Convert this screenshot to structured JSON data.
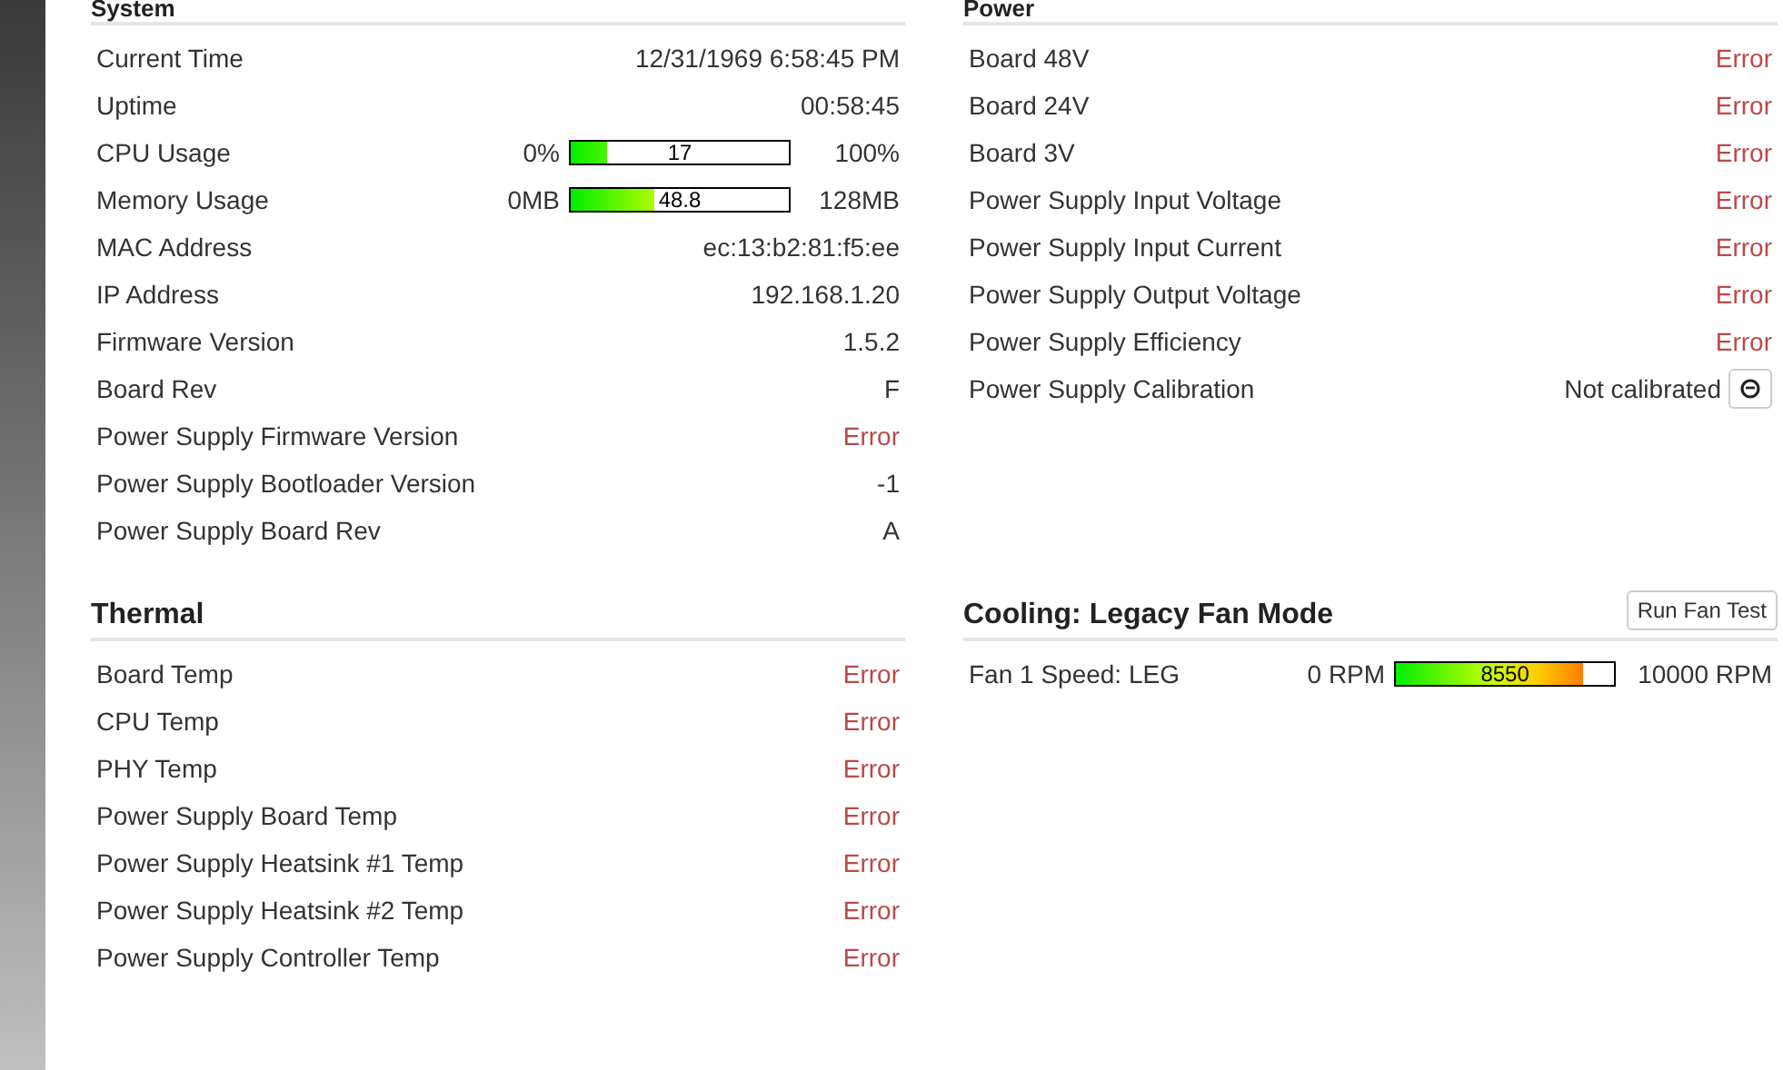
{
  "sections": [
    {
      "title": "System",
      "rows": [
        {
          "kind": "text",
          "label": "Current Time",
          "value": "12/31/1969 6:58:45 PM"
        },
        {
          "kind": "text",
          "label": "Uptime",
          "value": "00:58:45"
        },
        {
          "kind": "bar",
          "label": "CPU Usage",
          "min": "0%",
          "max": "100%",
          "reading": "17",
          "level": 0.17
        },
        {
          "kind": "bar",
          "label": "Memory Usage",
          "min": "0MB",
          "max": "128MB",
          "reading": "48.8",
          "level": 0.38
        },
        {
          "kind": "text",
          "label": "MAC Address",
          "value": "ec:13:b2:81:f5:ee"
        },
        {
          "kind": "text",
          "label": "IP Address",
          "value": "192.168.1.20"
        },
        {
          "kind": "text",
          "label": "Firmware Version",
          "value": "1.5.2"
        },
        {
          "kind": "text",
          "label": "Board Rev",
          "value": "F"
        },
        {
          "kind": "error",
          "label": "Power Supply Firmware Version",
          "value": "Error"
        },
        {
          "kind": "text",
          "label": "Power Supply Bootloader Version",
          "value": "-1"
        },
        {
          "kind": "text",
          "label": "Power Supply Board Rev",
          "value": "A"
        }
      ]
    },
    {
      "title": "Power",
      "rows": [
        {
          "kind": "error",
          "label": "Board 48V",
          "value": "Error"
        },
        {
          "kind": "error",
          "label": "Board 24V",
          "value": "Error"
        },
        {
          "kind": "error",
          "label": "Board 3V",
          "value": "Error"
        },
        {
          "kind": "error",
          "label": "Power Supply Input Voltage",
          "value": "Error"
        },
        {
          "kind": "error",
          "label": "Power Supply Input Current",
          "value": "Error"
        },
        {
          "kind": "error",
          "label": "Power Supply Output Voltage",
          "value": "Error"
        },
        {
          "kind": "error",
          "label": "Power Supply Efficiency",
          "value": "Error"
        },
        {
          "kind": "calibration",
          "label": "Power Supply Calibration",
          "value": "Not calibrated"
        }
      ]
    },
    {
      "title": "Thermal",
      "rows": [
        {
          "kind": "error",
          "label": "Board Temp",
          "value": "Error"
        },
        {
          "kind": "error",
          "label": "CPU Temp",
          "value": "Error"
        },
        {
          "kind": "error",
          "label": "PHY Temp",
          "value": "Error"
        },
        {
          "kind": "error",
          "label": "Power Supply Board Temp",
          "value": "Error"
        },
        {
          "kind": "error",
          "label": "Power Supply Heatsink #1 Temp",
          "value": "Error"
        },
        {
          "kind": "error",
          "label": "Power Supply Heatsink #2 Temp",
          "value": "Error"
        },
        {
          "kind": "error",
          "label": "Power Supply Controller Temp",
          "value": "Error"
        }
      ]
    },
    {
      "title": "Cooling: Legacy Fan Mode",
      "button": "Run Fan Test",
      "rows": [
        {
          "kind": "bar",
          "label": "Fan 1 Speed: LEG",
          "min": "0 RPM",
          "max": "10000 RPM",
          "reading": "8550",
          "level": 0.855
        }
      ]
    }
  ]
}
